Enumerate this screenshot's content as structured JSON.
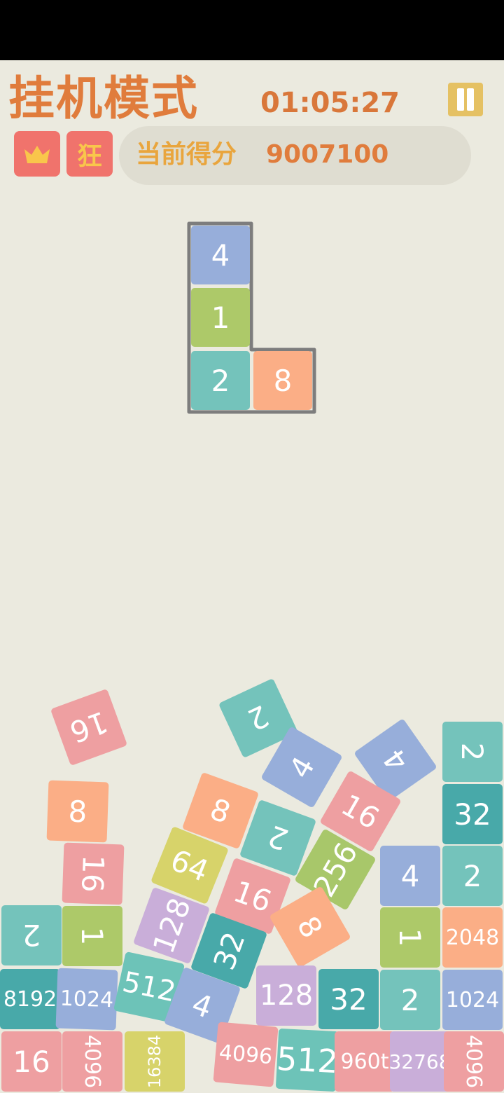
{
  "header": {
    "title": "挂机模式",
    "timer": "01:05:27",
    "badge_crown_icon": "crown-icon",
    "badge_mode_label": "狂",
    "score_label": "当前得分",
    "score_value": "9007100",
    "pause_icon": "pause-icon"
  },
  "colors": {
    "accent": "#E07C3C",
    "background": "#EBEADF",
    "badge": "#F0736C",
    "pause": "#E5C163"
  },
  "falling_piece": {
    "shape": "L",
    "cells": [
      {
        "value": "4",
        "row": 0,
        "col": 0
      },
      {
        "value": "1",
        "row": 1,
        "col": 0
      },
      {
        "value": "2",
        "row": 2,
        "col": 0
      },
      {
        "value": "8",
        "row": 2,
        "col": 1
      }
    ]
  },
  "board_blocks": [
    {
      "value": "16"
    },
    {
      "value": "2"
    },
    {
      "value": "4"
    },
    {
      "value": "4"
    },
    {
      "value": "2"
    },
    {
      "value": "8"
    },
    {
      "value": "8"
    },
    {
      "value": "16"
    },
    {
      "value": "32"
    },
    {
      "value": "16"
    },
    {
      "value": "2"
    },
    {
      "value": "64"
    },
    {
      "value": "256"
    },
    {
      "value": "4"
    },
    {
      "value": "2"
    },
    {
      "value": "16"
    },
    {
      "value": "2"
    },
    {
      "value": "1"
    },
    {
      "value": "128"
    },
    {
      "value": "8"
    },
    {
      "value": "1"
    },
    {
      "value": "2048"
    },
    {
      "value": "32"
    },
    {
      "value": "8192"
    },
    {
      "value": "1024"
    },
    {
      "value": "512"
    },
    {
      "value": "4"
    },
    {
      "value": "128"
    },
    {
      "value": "32"
    },
    {
      "value": "2"
    },
    {
      "value": "1024"
    },
    {
      "value": "16"
    },
    {
      "value": "4096"
    },
    {
      "value": "16384"
    },
    {
      "value": "4096"
    },
    {
      "value": "512"
    },
    {
      "value": "960t"
    },
    {
      "value": "32768"
    },
    {
      "value": "4096"
    }
  ]
}
